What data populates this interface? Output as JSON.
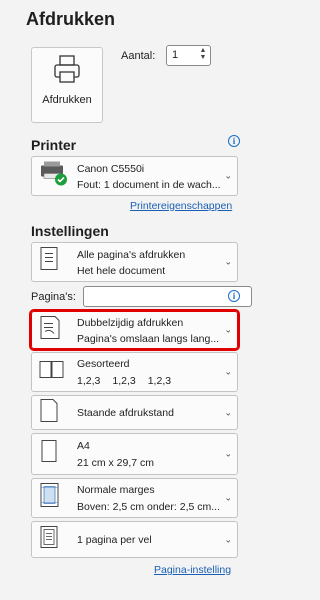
{
  "page": {
    "title": "Afdrukken"
  },
  "print_button": {
    "label": "Afdrukken",
    "icon": "printer-icon"
  },
  "copies": {
    "label": "Aantal:",
    "value": "1"
  },
  "printer": {
    "heading": "Printer",
    "name": "Canon C5550i",
    "status": "Fout: 1 document in de wach...",
    "properties_link": "Printereigenschappen"
  },
  "settings": {
    "heading": "Instellingen",
    "pages_label": "Pagina's:",
    "pages_value": "",
    "page_setup_link": "Pagina-instelling",
    "items": [
      {
        "line1": "Alle pagina's afdrukken",
        "line2": "Het hele document",
        "icon": "pages-icon"
      },
      {
        "line1": "Dubbelzijdig afdrukken",
        "line2": "Pagina's omslaan langs lang...",
        "icon": "duplex-icon",
        "highlighted": true
      },
      {
        "line1": "Gesorteerd",
        "collate": [
          "1,2,3",
          "1,2,3",
          "1,2,3"
        ],
        "icon": "collate-icon"
      },
      {
        "line1": "Staande afdrukstand",
        "icon": "portrait-icon"
      },
      {
        "line1": "A4",
        "line2": "21 cm x 29,7 cm",
        "icon": "paper-size-icon"
      },
      {
        "line1": "Normale marges",
        "line2": "Boven: 2,5 cm onder: 2,5 cm...",
        "icon": "margins-icon"
      },
      {
        "line1": "1 pagina per vel",
        "icon": "pages-per-sheet-icon"
      }
    ]
  },
  "colors": {
    "accent": "#1a5fb4",
    "highlight": "#e00000",
    "status_ok": "#1e9e3a"
  }
}
